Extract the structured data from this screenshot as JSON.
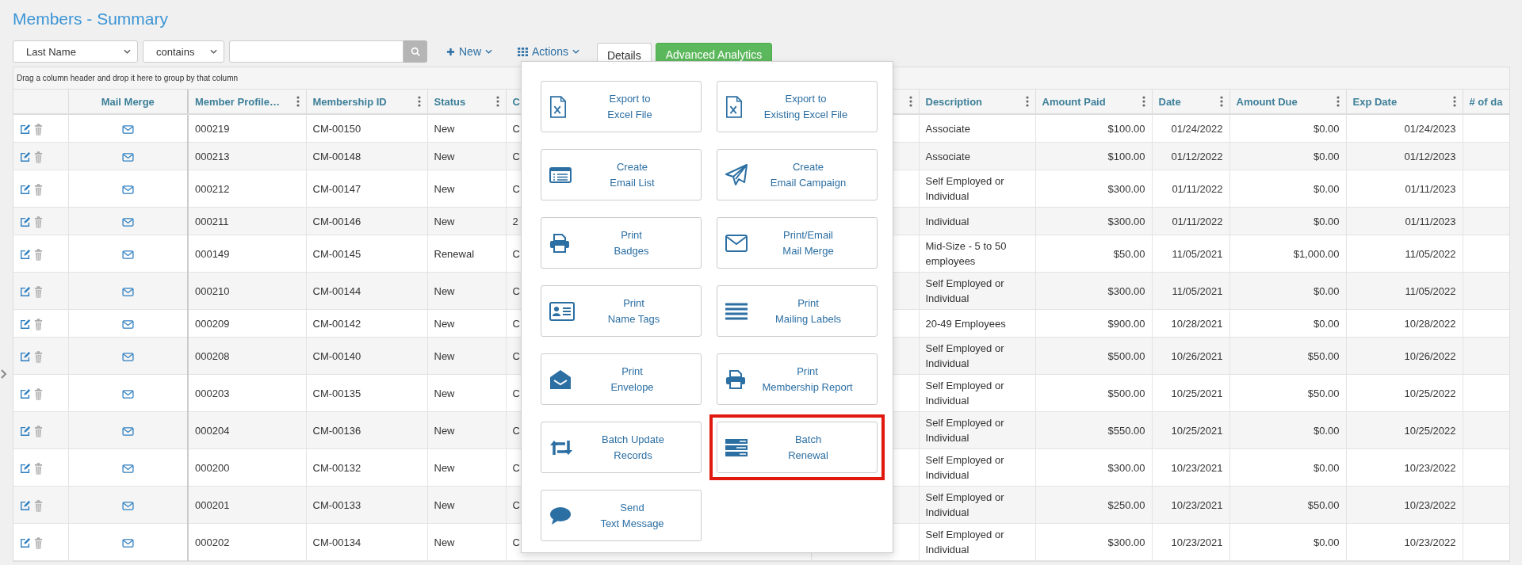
{
  "title": "Members - Summary",
  "filters": {
    "field": "Last Name",
    "operator": "contains"
  },
  "toolbar": [
    {
      "label": "New",
      "kind": "new"
    },
    {
      "label": "Actions",
      "kind": "actions"
    }
  ],
  "tabs": [
    {
      "label": "Details",
      "selected": true
    },
    {
      "label": "Advanced Analytics",
      "selected": false
    }
  ],
  "group_hint": "Drag a column header and drop it here to group by that column",
  "columns": [
    {
      "label": "Mail Merge",
      "menu": false
    },
    {
      "label": "Member Profile…",
      "menu": true
    },
    {
      "label": "Membership ID",
      "menu": true
    },
    {
      "label": "Status",
      "menu": true
    },
    {
      "label": "C"
    },
    {
      "menu": true
    },
    {
      "label": "Description",
      "menu": true
    },
    {
      "label": "Amount Paid",
      "menu": true
    },
    {
      "label": "Date",
      "menu": true
    },
    {
      "label": "Amount Due",
      "menu": true
    },
    {
      "label": "Exp Date",
      "menu": true
    },
    {
      "label": "# of da"
    }
  ],
  "rows": [
    {
      "profile": "000219",
      "membership_id": "CM-00150",
      "status": "New",
      "column_6": "C",
      "description": "Associate",
      "amount_paid": "$100.00",
      "date": "01/24/2022",
      "amount_due": "$0.00",
      "exp_date": "01/24/2023"
    },
    {
      "profile": "000213",
      "membership_id": "CM-00148",
      "status": "New",
      "column_6": "C",
      "description": "Associate",
      "amount_paid": "$100.00",
      "date": "01/12/2022",
      "amount_due": "$0.00",
      "exp_date": "01/12/2023"
    },
    {
      "profile": "000212",
      "membership_id": "CM-00147",
      "status": "New",
      "column_6": "C",
      "description": "Self Employed or Individual",
      "amount_paid": "$300.00",
      "date": "01/11/2022",
      "amount_due": "$0.00",
      "exp_date": "01/11/2023"
    },
    {
      "profile": "000211",
      "membership_id": "CM-00146",
      "status": "New",
      "column_6": "2",
      "description": "Individual",
      "amount_paid": "$300.00",
      "date": "01/11/2022",
      "amount_due": "$0.00",
      "exp_date": "01/11/2023"
    },
    {
      "profile": "000149",
      "membership_id": "CM-00145",
      "status": "Renewal",
      "column_6": "C",
      "description": "Mid-Size - 5 to 50 employees",
      "amount_paid": "$50.00",
      "date": "11/05/2021",
      "amount_due": "$1,000.00",
      "exp_date": "11/05/2022"
    },
    {
      "profile": "000210",
      "membership_id": "CM-00144",
      "status": "New",
      "column_6": "C",
      "description": "Self Employed or Individual",
      "amount_paid": "$300.00",
      "date": "11/05/2021",
      "amount_due": "$0.00",
      "exp_date": "11/05/2022"
    },
    {
      "profile": "000209",
      "membership_id": "CM-00142",
      "status": "New",
      "column_6": "C",
      "description": "20-49 Employees",
      "amount_paid": "$900.00",
      "date": "10/28/2021",
      "amount_due": "$0.00",
      "exp_date": "10/28/2022"
    },
    {
      "profile": "000208",
      "membership_id": "CM-00140",
      "status": "New",
      "column_6": "C",
      "description": "Self Employed or Individual",
      "amount_paid": "$500.00",
      "date": "10/26/2021",
      "amount_due": "$50.00",
      "exp_date": "10/26/2022"
    },
    {
      "profile": "000203",
      "membership_id": "CM-00135",
      "status": "New",
      "column_6": "C",
      "description": "Self Employed or Individual",
      "amount_paid": "$500.00",
      "date": "10/25/2021",
      "amount_due": "$50.00",
      "exp_date": "10/25/2022"
    },
    {
      "profile": "000204",
      "membership_id": "CM-00136",
      "status": "New",
      "column_6": "C",
      "description": "Self Employed or Individual",
      "amount_paid": "$550.00",
      "date": "10/25/2021",
      "amount_due": "$0.00",
      "exp_date": "10/25/2022"
    },
    {
      "profile": "000200",
      "membership_id": "CM-00132",
      "status": "New",
      "column_6": "C",
      "description": "Self Employed or Individual",
      "amount_paid": "$300.00",
      "date": "10/23/2021",
      "amount_due": "$0.00",
      "exp_date": "10/23/2022"
    },
    {
      "profile": "000201",
      "membership_id": "CM-00133",
      "status": "New",
      "column_6": "C",
      "description": "Self Employed or Individual",
      "amount_paid": "$250.00",
      "date": "10/23/2021",
      "amount_due": "$50.00",
      "exp_date": "10/23/2022"
    },
    {
      "profile": "000202",
      "membership_id": "CM-00134",
      "status": "New",
      "column_6": "C",
      "description": "Self Employed or Individual",
      "amount_paid": "$300.00",
      "date": "10/23/2021",
      "amount_due": "$0.00",
      "exp_date": "10/23/2022"
    }
  ],
  "menu": {
    "items": [
      {
        "lines": [
          "Export to",
          "Excel File"
        ],
        "highlighted": false
      },
      {
        "lines": [
          "Export to",
          "Existing Excel File"
        ],
        "highlighted": false
      },
      {
        "lines": [
          "Create",
          "Email List"
        ],
        "highlighted": false
      },
      {
        "lines": [
          "Create",
          "Email Campaign"
        ],
        "highlighted": false
      },
      {
        "lines": [
          "Print",
          "Badges"
        ],
        "highlighted": false
      },
      {
        "lines": [
          "Print/Email",
          "Mail Merge"
        ],
        "highlighted": false
      },
      {
        "lines": [
          "Print",
          "Name Tags"
        ],
        "highlighted": false
      },
      {
        "lines": [
          "Print",
          "Mailing Labels"
        ],
        "highlighted": false
      },
      {
        "lines": [
          "Print",
          "Envelope"
        ],
        "highlighted": false
      },
      {
        "lines": [
          "Print",
          "Membership Report"
        ],
        "highlighted": false
      },
      {
        "lines": [
          "Batch Update",
          "Records"
        ],
        "highlighted": false
      },
      {
        "lines": [
          "Batch",
          "Renewal"
        ],
        "highlighted": true
      },
      {
        "lines": [
          "Send",
          "Text Message"
        ],
        "highlighted": false
      }
    ]
  }
}
